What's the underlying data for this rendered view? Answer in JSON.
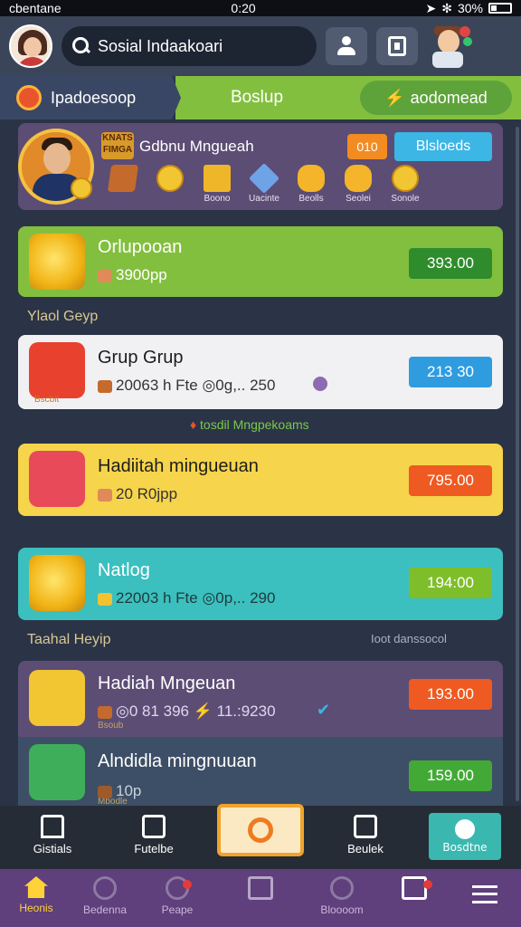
{
  "status_bar": {
    "carrier": "cbentane",
    "time": "0:20",
    "battery": "30%"
  },
  "header": {
    "search_placeholder": "Sosial Indaakoari"
  },
  "tabs": [
    {
      "label": "Ipadoesoop"
    },
    {
      "label": "Boslup"
    },
    {
      "label": "aodomead"
    }
  ],
  "profile": {
    "badge_text": "KNATS FIMGA",
    "title": "Gdbnu Mngueah",
    "level": "010",
    "action_label": "Blsloeds",
    "icons": [
      {
        "name": "crate",
        "label": ""
      },
      {
        "name": "coin",
        "label": ""
      },
      {
        "name": "gold",
        "label": "Boono"
      },
      {
        "name": "cube",
        "label": "Uacinte"
      },
      {
        "name": "gear",
        "label": "Beolls"
      },
      {
        "name": "gear2",
        "label": "Seolei"
      },
      {
        "name": "coins",
        "label": "Sonole"
      }
    ]
  },
  "cards": [
    {
      "title": "Orlupooan",
      "subtitle": "3900pp",
      "price": "393.00",
      "color": "#83bf3f",
      "button_color": "#2f8c2c"
    },
    {
      "title": "Grup Grup",
      "subtitle": "20063 h Fte ◎0g,.. 250",
      "price": "213 30",
      "color": "#f1f1f3",
      "button_color": "#2f9ce0",
      "icon_caption": "Bscbit"
    },
    {
      "title": "Hadiitah mingueuan",
      "subtitle": "20 R0jpp",
      "price": "795.00",
      "color": "#f6d44b",
      "button_color": "#ee5a22"
    },
    {
      "title": "Natlog",
      "subtitle": "22003 h Fte ◎0p,.. 290",
      "price": "194:00",
      "color": "#3cbfbf",
      "button_color": "#7fbe2b"
    },
    {
      "title": "Hadiah Mngeuan",
      "subtitle": "◎0 81 396 ⚡ 11.:9230",
      "price": "193.00",
      "color": "#5c4d75",
      "button_color": "#ee5a22",
      "icon_caption": "Bsoub"
    },
    {
      "title": "Alndidla mingnuuan",
      "subtitle": "10p",
      "price": "159.00",
      "color": "#3d4f66",
      "button_color": "#43a936",
      "icon_caption": "Mbodle"
    }
  ],
  "section_labels": {
    "first": "Ylaol Geyp",
    "mid": "tosdil Mngpekoams",
    "second": "Taahal Heyip",
    "second_right": "Ioot danssocol"
  },
  "bottom_bar": [
    {
      "label": "Gistials"
    },
    {
      "label": "Futelbe"
    },
    {
      "label": "Beulek"
    },
    {
      "label": "Bosdtne"
    }
  ],
  "bottom_nav": [
    {
      "label": "Heonis"
    },
    {
      "label": "Bedenna"
    },
    {
      "label": "Peape"
    },
    {
      "label": ""
    },
    {
      "label": "Bloooom"
    },
    {
      "label": ""
    }
  ]
}
